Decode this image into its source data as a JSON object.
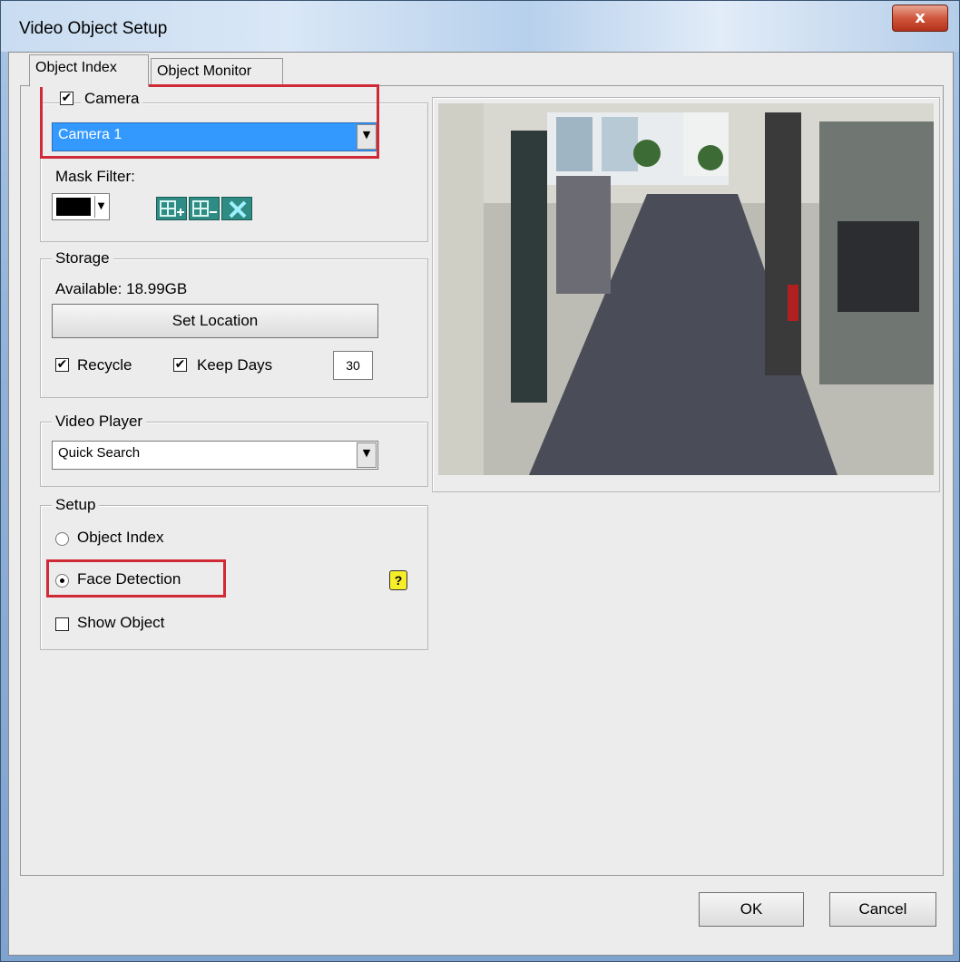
{
  "window": {
    "title": "Video Object Setup",
    "close_label": "x"
  },
  "tabs": [
    {
      "label": "Object Index",
      "active": true
    },
    {
      "label": "Object Monitor",
      "active": false
    }
  ],
  "camera": {
    "label": "Camera",
    "checked": true,
    "selected": "Camera 1",
    "mask_filter_label": "Mask Filter:",
    "mask_color": "#000000",
    "mask_tools": [
      "grid-add-icon",
      "grid-remove-icon",
      "clear-icon"
    ]
  },
  "storage": {
    "label": "Storage",
    "available": "Available: 18.99GB",
    "set_location_label": "Set Location",
    "recycle_label": "Recycle",
    "recycle_checked": true,
    "keep_days_label": "Keep Days",
    "keep_days_checked": true,
    "keep_days_value": "30"
  },
  "video_player": {
    "label": "Video Player",
    "selected": "Quick Search"
  },
  "setup": {
    "label": "Setup",
    "object_index_label": "Object Index",
    "face_detection_label": "Face Detection",
    "selected": "Face Detection",
    "show_object_label": "Show Object",
    "show_object_checked": false,
    "help_icon": "help-icon"
  },
  "preview": {
    "description_icon": "camera-preview-image"
  },
  "footer": {
    "ok_label": "OK",
    "cancel_label": "Cancel"
  },
  "colors": {
    "highlight": "#cf2a36",
    "selection": "#3399ff"
  }
}
